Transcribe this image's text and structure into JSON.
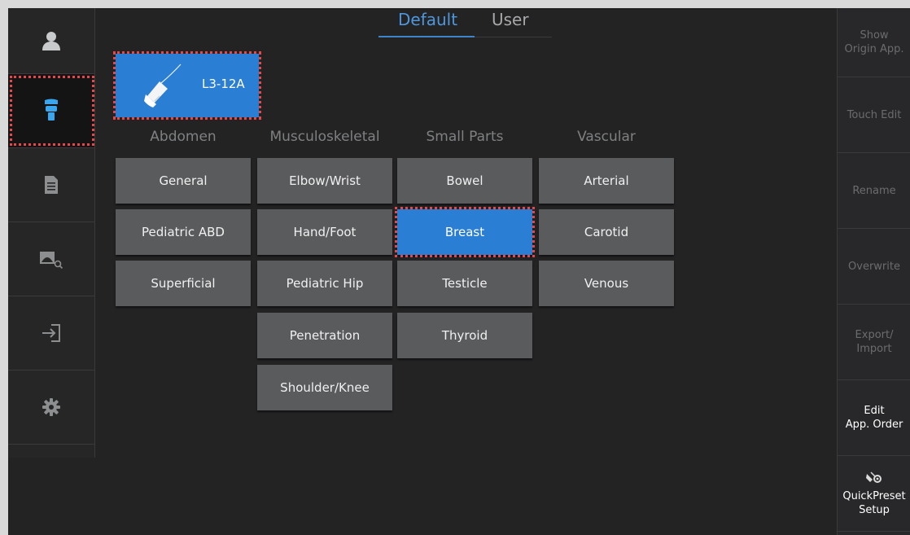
{
  "tabs": {
    "default_label": "Default",
    "user_label": "User",
    "active": "Default"
  },
  "sidebar": {
    "items": [
      {
        "name": "patient",
        "icon": "person-icon"
      },
      {
        "name": "probe",
        "icon": "probe-icon",
        "active": true
      },
      {
        "name": "report",
        "icon": "document-icon"
      },
      {
        "name": "review",
        "icon": "image-search-icon"
      },
      {
        "name": "end-exam",
        "icon": "exit-arrow-icon"
      },
      {
        "name": "settings",
        "icon": "gear-icon"
      }
    ]
  },
  "probe": {
    "label": "L3-12A"
  },
  "categories": [
    "Abdomen",
    "Musculoskeletal",
    "Small Parts",
    "Vascular"
  ],
  "presets": {
    "abdomen": [
      "General",
      "Pediatric ABD",
      "Superficial"
    ],
    "musculoskeletal": [
      "Elbow/Wrist",
      "Hand/Foot",
      "Pediatric Hip",
      "Penetration",
      "Shoulder/Knee"
    ],
    "small_parts": [
      "Bowel",
      "Breast",
      "Testicle",
      "Thyroid"
    ],
    "vascular": [
      "Arterial",
      "Carotid",
      "Venous"
    ],
    "selected": "Breast"
  },
  "right_panel": {
    "show_origin": [
      "Show",
      "Origin App."
    ],
    "touch_edit": "Touch Edit",
    "rename": "Rename",
    "overwrite": "Overwrite",
    "export_import": [
      "Export/",
      "Import"
    ],
    "edit_order": [
      "Edit",
      "App. Order"
    ],
    "quickpreset": [
      "QuickPreset",
      "Setup"
    ]
  },
  "colors": {
    "accent": "#2a7ed4",
    "highlight_dots": "#e8464a",
    "button": "#5a5b5d",
    "background": "#232324"
  }
}
